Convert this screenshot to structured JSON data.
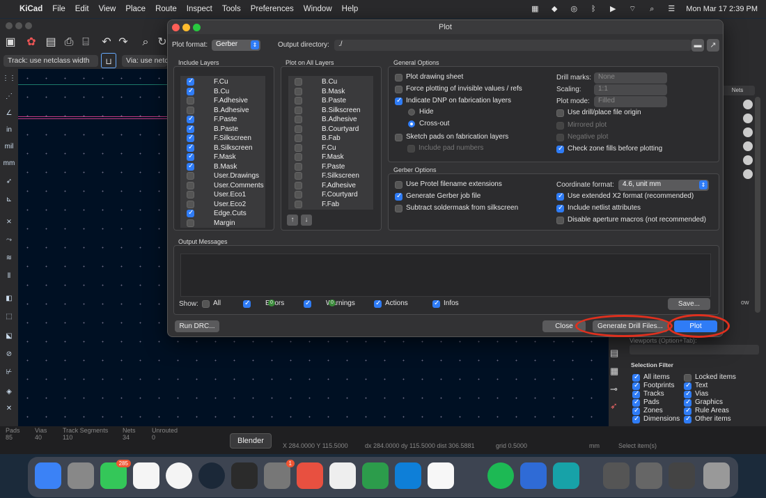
{
  "menubar": {
    "app_name": "KiCad",
    "items": [
      "File",
      "Edit",
      "View",
      "Place",
      "Route",
      "Inspect",
      "Tools",
      "Preferences",
      "Window",
      "Help"
    ],
    "clock": "Mon Mar 17  2:39 PM"
  },
  "kicad": {
    "track_width": "Track: use netclass width",
    "via_size": "Via: use netc",
    "units": [
      "in",
      "mil",
      "mm"
    ],
    "nets_tab": "Nets",
    "hidden_label": "Viewports (Option+Tab):",
    "right_partial": "ow",
    "status": {
      "labels": [
        "Pads",
        "Vias",
        "Track Segments",
        "Nets",
        "Unrouted"
      ],
      "values": [
        "85",
        "40",
        "110",
        "34",
        "0"
      ],
      "coords": "X 284.0000  Y 115.5000",
      "delta": "dx 284.0000  dy 115.5000  dist 306.5881",
      "grid": "grid 0.5000",
      "units": "mm",
      "select": "Select item(s)"
    },
    "selection_filter": {
      "title": "Selection Filter",
      "left": [
        "All items",
        "Footprints",
        "Tracks",
        "Pads",
        "Zones",
        "Dimensions"
      ],
      "right": [
        "Locked items",
        "Text",
        "Vias",
        "Graphics",
        "Rule Areas",
        "Other items"
      ]
    }
  },
  "dialog": {
    "title": "Plot",
    "plot_format_label": "Plot format:",
    "plot_format_value": "Gerber",
    "output_dir_label": "Output directory:",
    "output_dir_value": "./",
    "include_layers_title": "Include Layers",
    "include_layers": [
      {
        "name": "F.Cu",
        "checked": true
      },
      {
        "name": "B.Cu",
        "checked": true
      },
      {
        "name": "F.Adhesive",
        "checked": false
      },
      {
        "name": "B.Adhesive",
        "checked": false
      },
      {
        "name": "F.Paste",
        "checked": true
      },
      {
        "name": "B.Paste",
        "checked": true
      },
      {
        "name": "F.Silkscreen",
        "checked": true
      },
      {
        "name": "B.Silkscreen",
        "checked": true
      },
      {
        "name": "F.Mask",
        "checked": true
      },
      {
        "name": "B.Mask",
        "checked": true
      },
      {
        "name": "User.Drawings",
        "checked": false
      },
      {
        "name": "User.Comments",
        "checked": false
      },
      {
        "name": "User.Eco1",
        "checked": false
      },
      {
        "name": "User.Eco2",
        "checked": false
      },
      {
        "name": "Edge.Cuts",
        "checked": true
      },
      {
        "name": "Margin",
        "checked": false
      }
    ],
    "plot_all_title": "Plot on All Layers",
    "plot_all_layers": [
      "B.Cu",
      "B.Mask",
      "B.Paste",
      "B.Silkscreen",
      "B.Adhesive",
      "B.Courtyard",
      "B.Fab",
      "F.Cu",
      "F.Mask",
      "F.Paste",
      "F.Silkscreen",
      "F.Adhesive",
      "F.Courtyard",
      "F.Fab"
    ],
    "general_title": "General Options",
    "general": {
      "plot_sheet": "Plot drawing sheet",
      "force_invisible": "Force plotting of invisible values / refs",
      "indicate_dnp": "Indicate DNP on fabrication layers",
      "hide": "Hide",
      "crossout": "Cross-out",
      "sketch_pads": "Sketch pads on fabrication layers",
      "include_pad_numbers": "Include pad numbers",
      "drill_marks_label": "Drill marks:",
      "drill_marks_value": "None",
      "scaling_label": "Scaling:",
      "scaling_value": "1:1",
      "plot_mode_label": "Plot mode:",
      "plot_mode_value": "Filled",
      "use_drill_origin": "Use drill/place file origin",
      "mirrored": "Mirrored plot",
      "negative": "Negative plot",
      "check_zone": "Check zone fills before plotting"
    },
    "gerber_title": "Gerber Options",
    "gerber": {
      "protel": "Use Protel filename extensions",
      "job_file": "Generate Gerber job file",
      "subtract_mask": "Subtract soldermask from silkscreen",
      "coord_label": "Coordinate format:",
      "coord_value": "4.6, unit mm",
      "x2": "Use extended X2 format (recommended)",
      "netlist": "Include netlist attributes",
      "aperture": "Disable aperture macros (not recommended)"
    },
    "output_messages_title": "Output Messages",
    "show_label": "Show:",
    "filters": {
      "all": "All",
      "errors": "Errors",
      "warnings": "Warnings",
      "actions": "Actions",
      "infos": "Infos",
      "errors_count": "0",
      "warnings_count": "0"
    },
    "save_button": "Save...",
    "run_drc": "Run DRC...",
    "close": "Close",
    "gen_drill": "Generate Drill Files...",
    "plot": "Plot"
  },
  "dock": {
    "tooltip": "Blender",
    "badges": {
      "messages": "285",
      "settings": "1"
    }
  }
}
